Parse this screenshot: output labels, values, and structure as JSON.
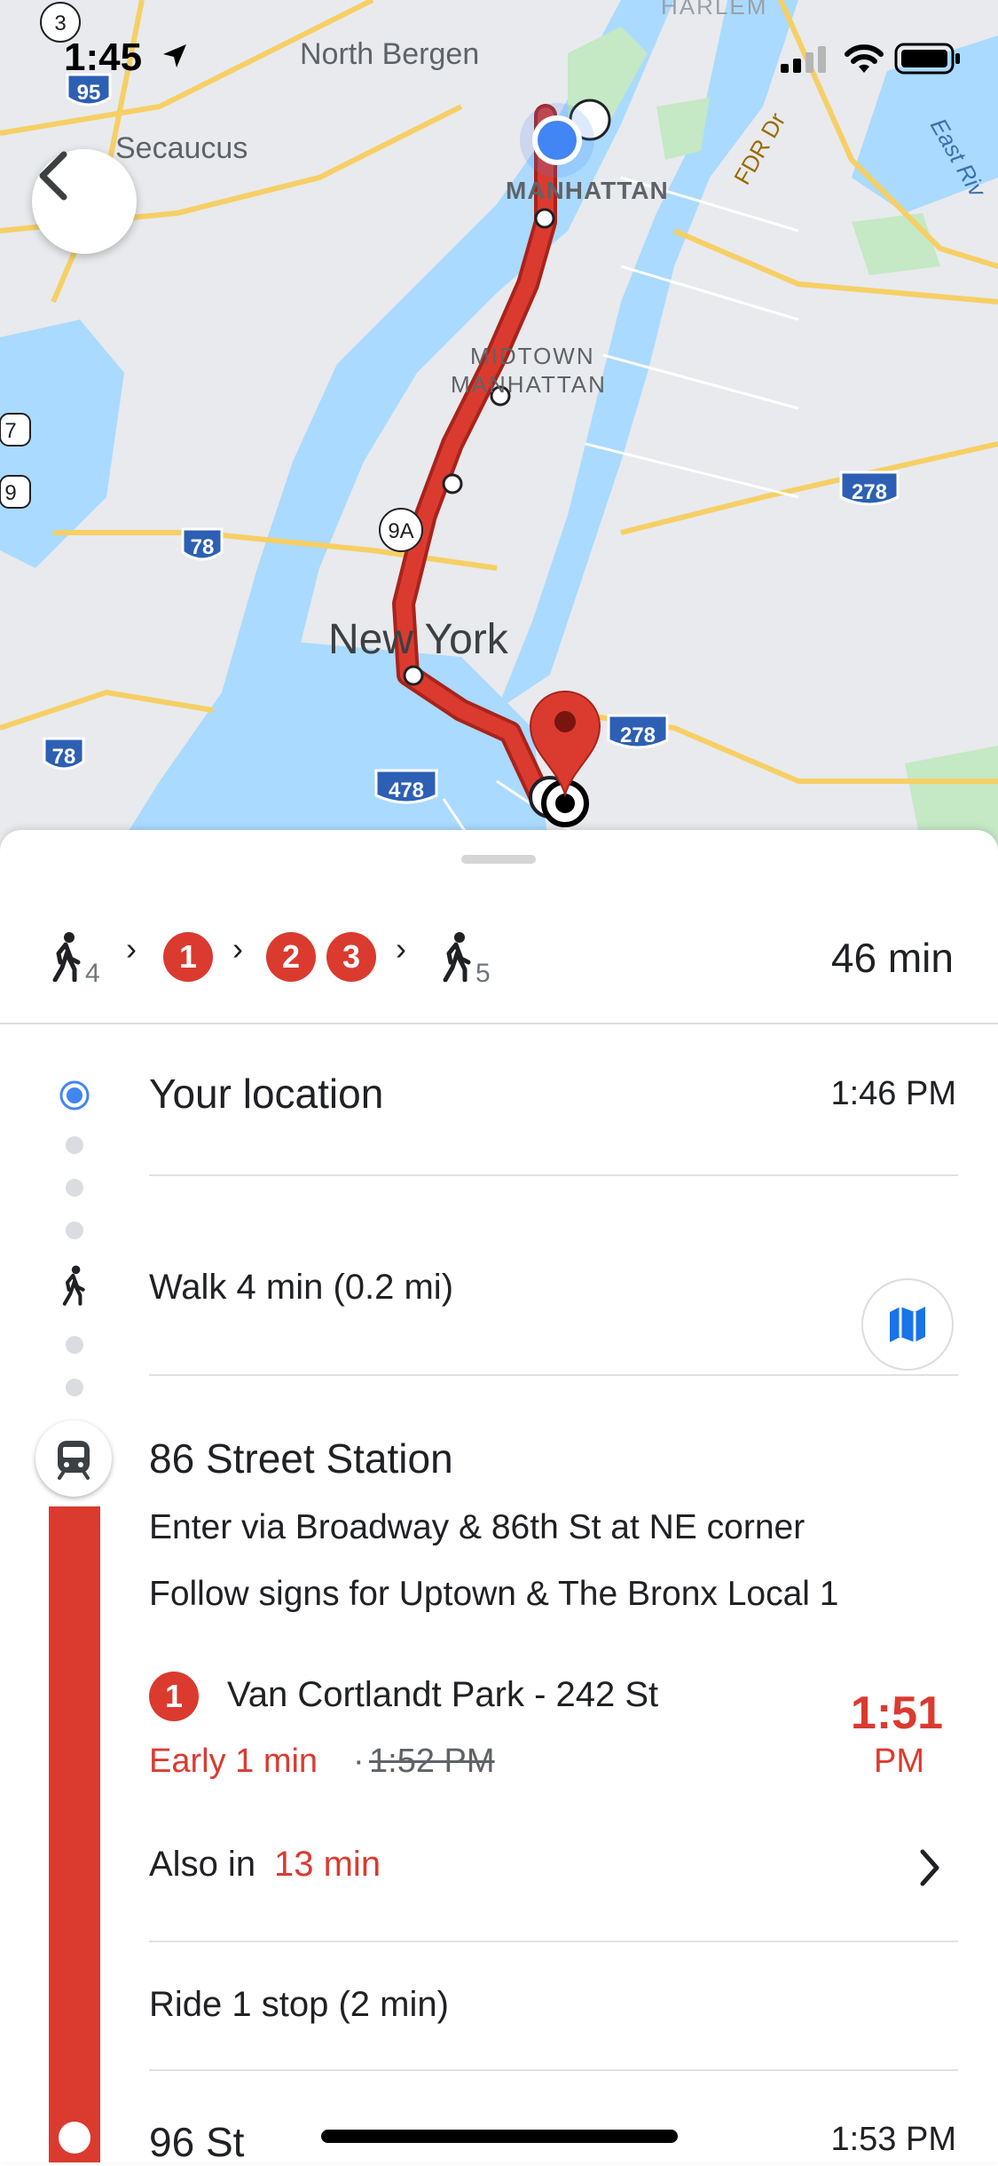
{
  "status_bar": {
    "time": "1:45"
  },
  "map": {
    "labels": {
      "harlem": "HARLEM",
      "north_bergen": "North Bergen",
      "secaucus": "Secaucus",
      "manhattan": "MANHATTAN",
      "fdr": "FDR Dr",
      "east_river": "East Riv",
      "midtown_1": "MIDTOWN",
      "midtown_2": "MANHATTAN",
      "new_york": "New York"
    },
    "shields": {
      "r3": "3",
      "i95": "95",
      "r7": "7",
      "r9": "9",
      "i78a": "78",
      "r9a": "9A",
      "i278a": "278",
      "i278b": "278",
      "i78b": "78",
      "i478": "478"
    },
    "colors": {
      "route": "#db3a2f",
      "water": "#aadaff",
      "land": "#e8eaed",
      "park": "#c5e8c5"
    }
  },
  "summary": {
    "walk_start_min": "4",
    "line_1": "1",
    "line_2": "2",
    "line_3": "3",
    "walk_end_min": "5",
    "duration": "46 min"
  },
  "steps": {
    "origin_title": "Your location",
    "origin_time": "1:46 PM",
    "walk_text": "Walk 4 min (0.2 mi)",
    "station_title": "86 Street Station",
    "enter_text": "Enter via Broadway & 86th St at NE corner",
    "follow_text": "Follow signs for Uptown & The Bronx Local 1",
    "train_line": "1",
    "train_destination": "Van Cortlandt Park - 242 St",
    "early_text": "Early 1 min",
    "sep": "·",
    "scheduled_time": "1:52 PM",
    "depart_time": "1:51",
    "depart_ampm": "PM",
    "also_in_prefix": "Also in ",
    "also_in_value": "13 min",
    "ride_text": "Ride 1 stop (2 min)",
    "next_stop": "96 St",
    "next_stop_time": "1:53 PM"
  },
  "colors": {
    "accent_red": "#db3a2f",
    "blue_dot": "#4285f4",
    "text": "#202124"
  }
}
